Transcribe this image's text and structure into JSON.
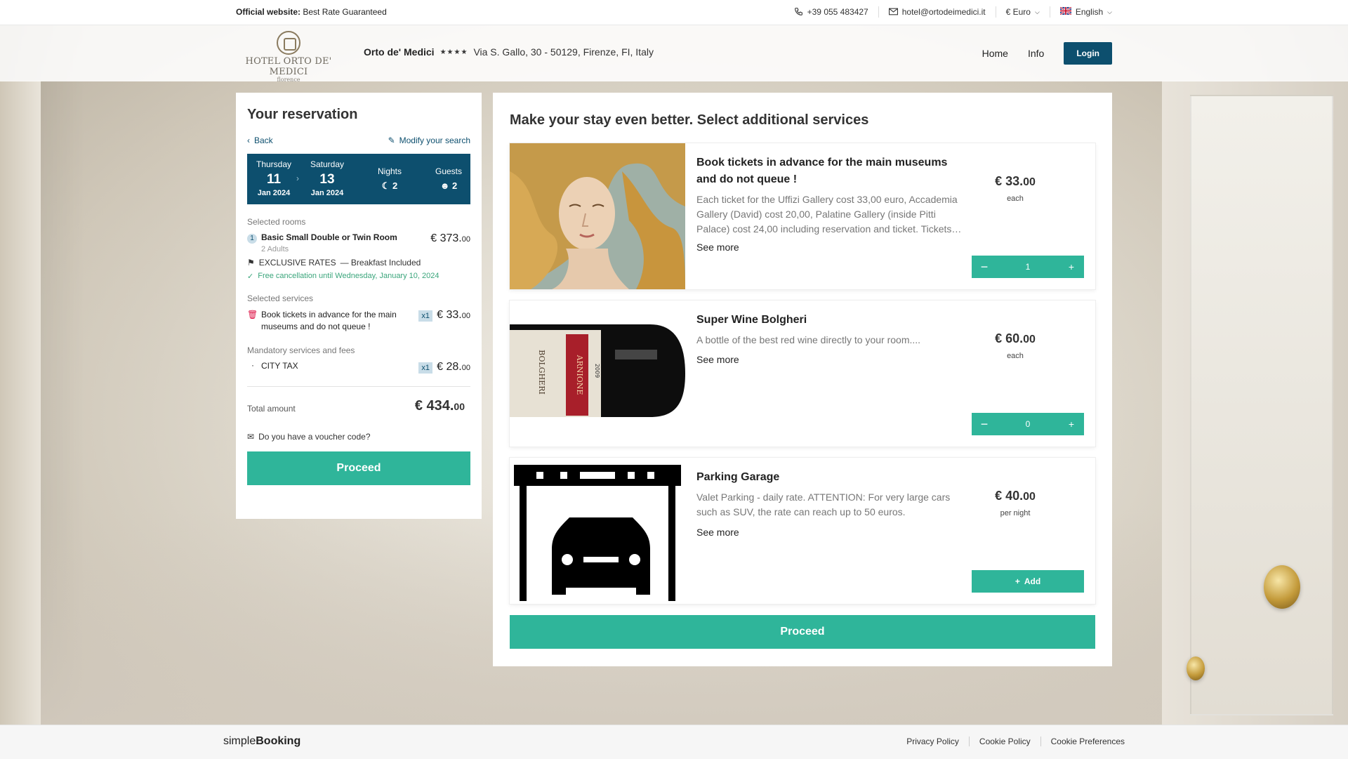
{
  "topbar": {
    "official_bold": "Official website:",
    "official_rest": "Best Rate Guaranteed",
    "phone": "+39 055 483427",
    "email": "hotel@ortodeimedici.it",
    "currency": "€ Euro",
    "language": "English"
  },
  "header": {
    "logo_name": "HOTEL ORTO DE' MEDICI",
    "logo_city": "florence",
    "hotel_name": "Orto de' Medici",
    "stars": "★★★★",
    "address": "Via S. Gallo, 30 - 50129, Firenze, FI, Italy",
    "nav": {
      "home": "Home",
      "info": "Info",
      "login": "Login"
    }
  },
  "reservation": {
    "title": "Your reservation",
    "back": "Back",
    "modify": "Modify your search",
    "checkin": {
      "day": "Thursday",
      "date": "11",
      "month": "Jan 2024"
    },
    "checkout": {
      "day": "Saturday",
      "date": "13",
      "month": "Jan 2024"
    },
    "nights_label": "Nights",
    "nights": "2",
    "guests_label": "Guests",
    "guests": "2",
    "selected_rooms_label": "Selected rooms",
    "room": {
      "num": "1",
      "name": "Basic Small Double or Twin Room",
      "adults": "2 Adults",
      "price_main": "€ 373.",
      "price_cents": "00",
      "rate": "EXCLUSIVE RATES",
      "rate_extra": "— Breakfast Included",
      "cancellation": "Free cancellation until Wednesday, January 10, 2024"
    },
    "selected_services_label": "Selected services",
    "service": {
      "name": "Book tickets in advance for the main museums and do not queue !",
      "qty": "x1",
      "price_main": "€ 33.",
      "price_cents": "00"
    },
    "mandatory_label": "Mandatory services and fees",
    "tax": {
      "name": "CITY TAX",
      "qty": "x1",
      "price_main": "€ 28.",
      "price_cents": "00"
    },
    "total_label": "Total amount",
    "total_main": "€ 434.",
    "total_cents": "00",
    "voucher": "Do you have a voucher code?",
    "proceed": "Proceed"
  },
  "services": {
    "title": "Make your stay even better. Select additional services",
    "items": [
      {
        "title": "Book tickets in advance for the main museums and do not queue !",
        "desc": "Each ticket for the Uffizi Gallery cost 33,00 euro, Accademia Gallery (David) cost 20,00, Palatine Gallery (inside Pitti Palace) cost 24,00 including reservation and ticket. Tickets…",
        "more": "See more",
        "price_main": "€ 33.",
        "price_cents": "00",
        "unit": "each",
        "qty": "1"
      },
      {
        "title": "Super Wine Bolgheri",
        "desc": "A bottle of the best red wine directly to your room....",
        "more": "See more",
        "price_main": "€ 60.",
        "price_cents": "00",
        "unit": "each",
        "qty": "0",
        "label_text": "ARNIONE",
        "label_side": "BOLGHERI",
        "label_year": "2009"
      },
      {
        "title": "Parking Garage",
        "desc": "Valet Parking - daily rate. ATTENTION: For very large cars such as SUV, the rate can reach up to 50 euros.",
        "more": "See more",
        "price_main": "€ 40.",
        "price_cents": "00",
        "unit": "per night",
        "add": "Add"
      }
    ],
    "proceed": "Proceed"
  },
  "footer": {
    "brand_light": "simple",
    "brand_bold": "Booking",
    "links": [
      "Privacy Policy",
      "Cookie Policy",
      "Cookie Preferences"
    ]
  },
  "colors": {
    "primary": "#0d4f6e",
    "accent": "#2fb59a",
    "green_text": "#3aa57b",
    "danger": "#d14"
  }
}
